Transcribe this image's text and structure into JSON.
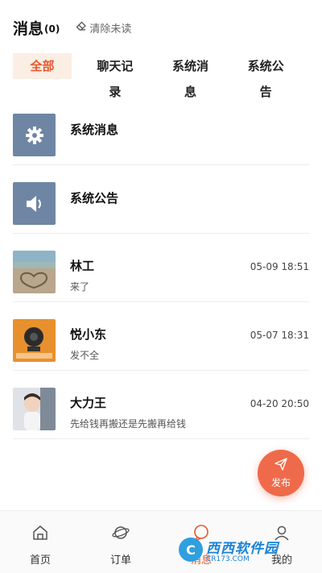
{
  "header": {
    "title": "消息",
    "count": "(0)",
    "clear_label": "清除未读"
  },
  "tabs": [
    {
      "label": "全部",
      "active": true
    },
    {
      "label": "聊天记录",
      "active": false
    },
    {
      "label": "系统消息",
      "active": false
    },
    {
      "label": "系统公告",
      "active": false
    }
  ],
  "messages": [
    {
      "type": "system",
      "icon": "gear-icon",
      "name": "系统消息"
    },
    {
      "type": "system",
      "icon": "speaker-icon",
      "name": "系统公告"
    },
    {
      "type": "chat",
      "avatar": "beach-heart-photo",
      "name": "林工",
      "time": "05-09 18:51",
      "preview": "来了"
    },
    {
      "type": "chat",
      "avatar": "camera-product-photo",
      "name": "悦小东",
      "time": "05-07 18:31",
      "preview": "发不全"
    },
    {
      "type": "chat",
      "avatar": "child-photo",
      "name": "大力王",
      "time": "04-20 20:50",
      "preview": "先给钱再搬还是先搬再给钱"
    }
  ],
  "fab": {
    "label": "发布",
    "icon": "paper-plane-icon"
  },
  "nav": [
    {
      "label": "首页",
      "icon": "home-icon",
      "active": false
    },
    {
      "label": "订单",
      "icon": "planet-icon",
      "active": false
    },
    {
      "label": "消息",
      "icon": "message-icon",
      "active": true
    },
    {
      "label": "我的",
      "icon": "user-icon",
      "active": false
    }
  ],
  "watermark": {
    "main": "西西软件园",
    "sub": "CR173.COM"
  },
  "colors": {
    "accent": "#e9562d",
    "accent_bg": "#fbeee4",
    "system_icon_bg": "#6e86a3",
    "fab": "#ef6a4a"
  }
}
